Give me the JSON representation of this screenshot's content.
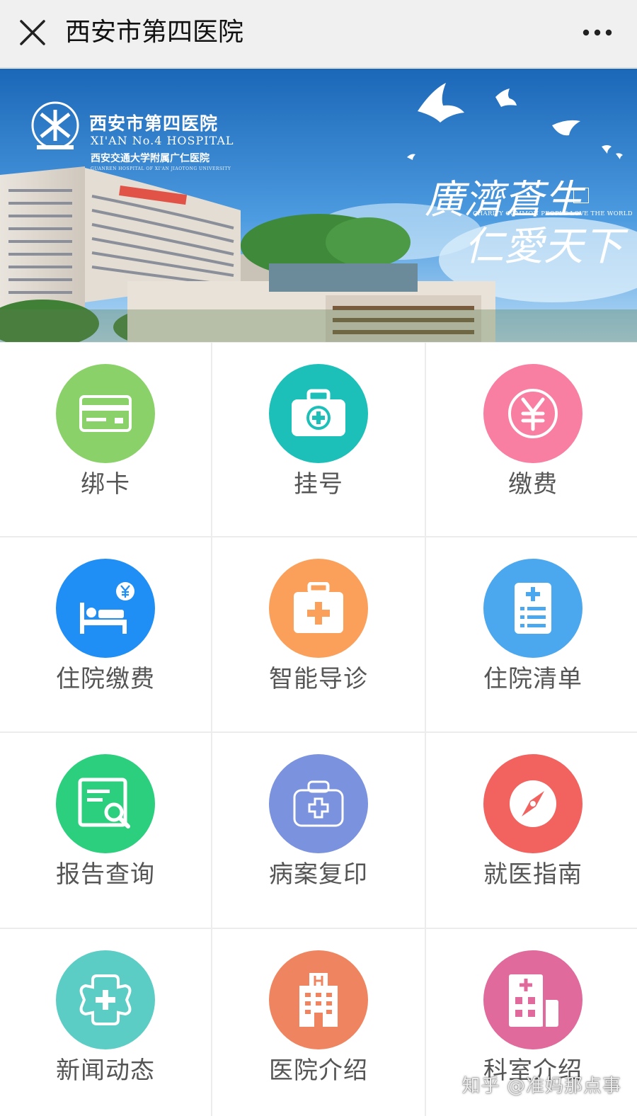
{
  "header": {
    "title": "西安市第四医院",
    "close_icon": "close-icon",
    "more_icon": "more-icon"
  },
  "banner": {
    "hospital_name_cn": "西安市第四医院",
    "hospital_name_en": "XI'AN No.4 HOSPITAL",
    "affiliation_cn": "西安交通大学附属广仁医院",
    "affiliation_en": "GUANREN HOSPITAL OF XI'AN JIAOTONG UNIVERSITY",
    "slogan_line1": "廣濟蒼生",
    "slogan_en": "CHARITY COMMON PEOPLE LOVE THE WORLD",
    "slogan_line2": "仁愛天下"
  },
  "menu": [
    {
      "label": "绑卡",
      "icon": "card-icon",
      "color": "#8bd16a"
    },
    {
      "label": "挂号",
      "icon": "medical-kit-icon",
      "color": "#1cc0b8"
    },
    {
      "label": "缴费",
      "icon": "yuan-icon",
      "color": "#f97fa2"
    },
    {
      "label": "住院缴费",
      "icon": "hospital-bed-icon",
      "color": "#1f8ef5"
    },
    {
      "label": "智能导诊",
      "icon": "first-aid-icon",
      "color": "#fba05a"
    },
    {
      "label": "住院清单",
      "icon": "list-icon",
      "color": "#4ba8ee"
    },
    {
      "label": "报告查询",
      "icon": "report-search-icon",
      "color": "#2ccf7d"
    },
    {
      "label": "病案复印",
      "icon": "medical-bag-icon",
      "color": "#7b92df"
    },
    {
      "label": "就医指南",
      "icon": "compass-icon",
      "color": "#f2625f"
    },
    {
      "label": "新闻动态",
      "icon": "news-cross-icon",
      "color": "#5ccdc5"
    },
    {
      "label": "医院介绍",
      "icon": "hospital-building-icon",
      "color": "#ef8560"
    },
    {
      "label": "科室介绍",
      "icon": "department-icon",
      "color": "#e06a9b"
    }
  ],
  "watermark": "知乎 @准妈那点事"
}
